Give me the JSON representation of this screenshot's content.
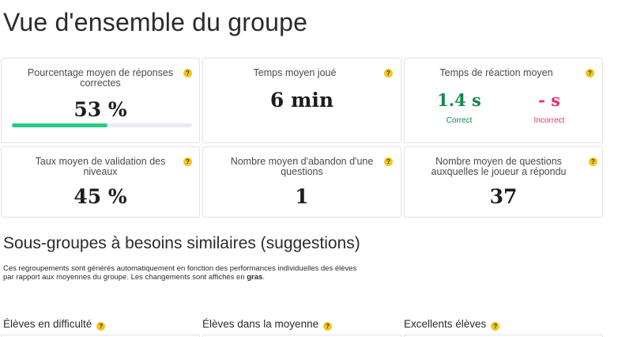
{
  "page_title": "Vue d'ensemble du groupe",
  "help_glyph": "?",
  "cards": {
    "accuracy": {
      "title": "Pourcentage moyen de réponses correctes",
      "value": "53 %",
      "progress": 0.53,
      "progress_color": "#27cb86"
    },
    "time_played": {
      "title": "Temps moyen joué",
      "value": "6 min"
    },
    "reaction": {
      "title": "Temps de réaction moyen",
      "correct_value": "1.4 s",
      "correct_label": "Correct",
      "correct_color": "#0f8a4a",
      "incorrect_value": "- s",
      "incorrect_label": "Incorrect",
      "incorrect_color": "#e8306a"
    },
    "validation": {
      "title": "Taux moyen de validation des niveaux",
      "value": "45 %"
    },
    "abandon": {
      "title": "Nombre moyen d'abandon d'une questions",
      "value": "1"
    },
    "answered": {
      "title": "Nombre moyen de questions auxquelles le joueur a répondu",
      "value": "37"
    }
  },
  "subgroups": {
    "title": "Sous-groupes à besoins similaires (suggestions)",
    "description_start": "Ces regroupements sont générés automatiquement en fonction des performances individuelles des élèves par rapport aux moyennes du groupe. Les changements sont affichés en ",
    "description_bold": "gras",
    "description_end": ".",
    "columns": [
      "Élèves en difficulté",
      "Élèves dans la moyenne",
      "Excellents élèves"
    ]
  },
  "colors": {
    "help_badge": "#f6c51b",
    "card_border": "#e3e3e3"
  }
}
